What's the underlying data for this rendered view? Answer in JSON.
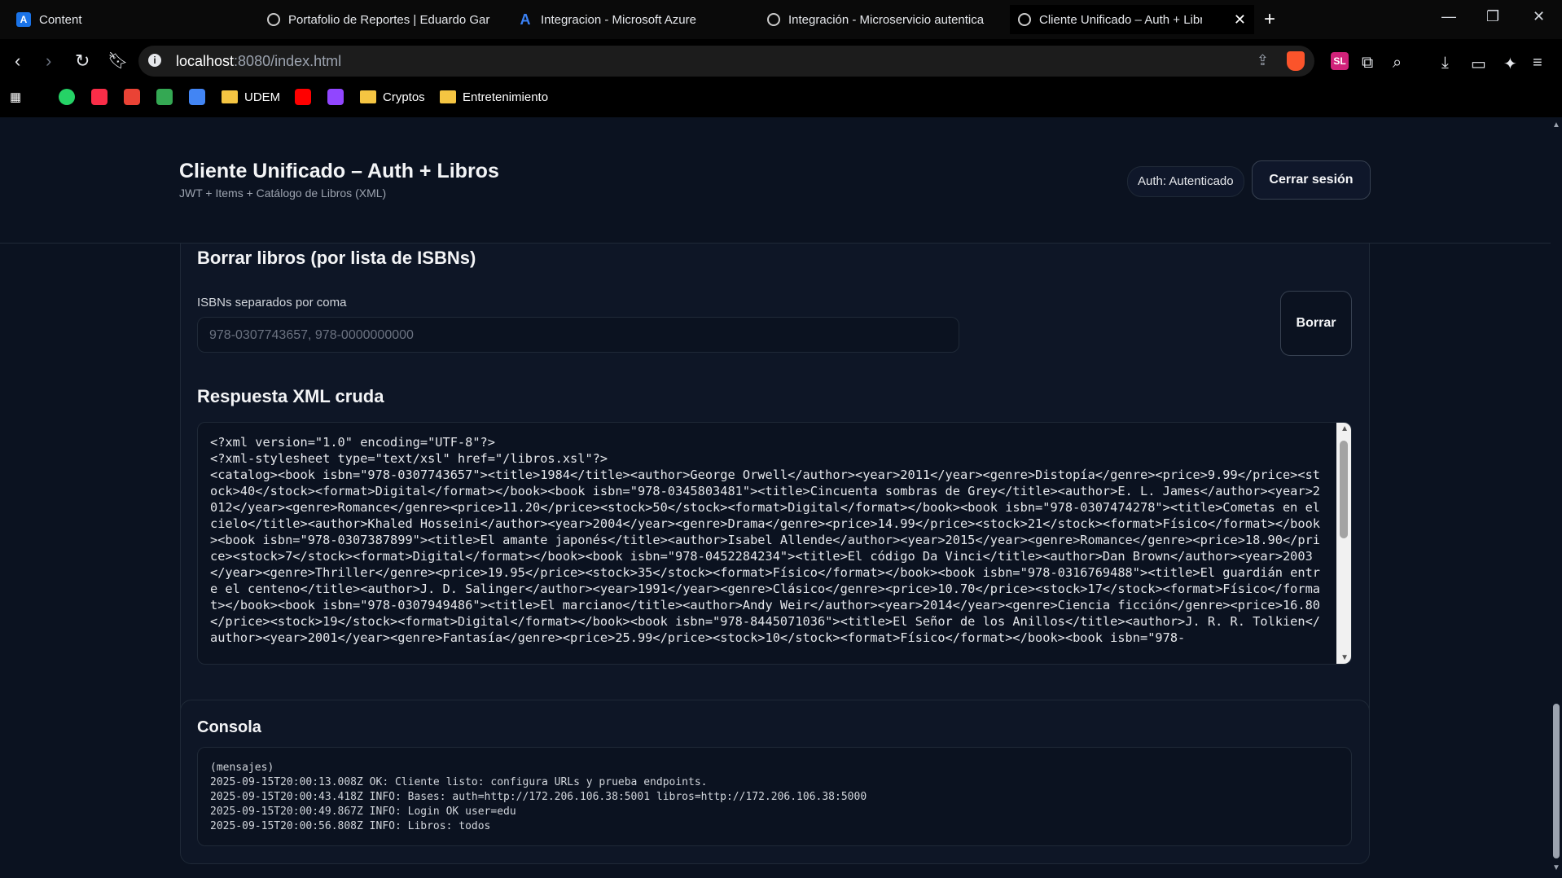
{
  "browser": {
    "tabs": [
      {
        "title": "Content",
        "favicon": "A"
      },
      {
        "title": "Portafolio de Reportes | Eduardo Gar",
        "favicon": "globe"
      },
      {
        "title": "Integracion - Microsoft Azure",
        "favicon": "azure"
      },
      {
        "title": "Integración - Microservicio autentica",
        "favicon": "openai"
      },
      {
        "title": "Cliente Unificado – Auth + Libros",
        "favicon": "globe"
      }
    ],
    "url_host": "localhost",
    "url_rest": ":8080/index.html",
    "bookmarks": [
      "UDEM",
      "Cryptos",
      "Entretenimiento"
    ],
    "ext_sl": "SL"
  },
  "header": {
    "title": "Cliente Unificado – Auth + Libros",
    "subtitle": "JWT + Items + Catálogo de Libros (XML)",
    "auth_status": "Auth: Autenticado",
    "logout_label": "Cerrar sesión"
  },
  "delete_section": {
    "title": "Borrar libros (por lista de ISBNs)",
    "label": "ISBNs separados por coma",
    "placeholder": "978-0307743657, 978-0000000000",
    "button": "Borrar"
  },
  "xml_section": {
    "title": "Respuesta XML cruda",
    "content": "<?xml version=\"1.0\" encoding=\"UTF-8\"?>\n<?xml-stylesheet type=\"text/xsl\" href=\"/libros.xsl\"?>\n<catalog><book isbn=\"978-0307743657\"><title>1984</title><author>George Orwell</author><year>2011</year><genre>Distopía</genre><price>9.99</price><stock>40</stock><format>Digital</format></book><book isbn=\"978-0345803481\"><title>Cincuenta sombras de Grey</title><author>E. L. James</author><year>2012</year><genre>Romance</genre><price>11.20</price><stock>50</stock><format>Digital</format></book><book isbn=\"978-0307474278\"><title>Cometas en el cielo</title><author>Khaled Hosseini</author><year>2004</year><genre>Drama</genre><price>14.99</price><stock>21</stock><format>Físico</format></book><book isbn=\"978-0307387899\"><title>El amante japonés</title><author>Isabel Allende</author><year>2015</year><genre>Romance</genre><price>18.90</price><stock>7</stock><format>Digital</format></book><book isbn=\"978-0452284234\"><title>El código Da Vinci</title><author>Dan Brown</author><year>2003</year><genre>Thriller</genre><price>19.95</price><stock>35</stock><format>Físico</format></book><book isbn=\"978-0316769488\"><title>El guardián entre el centeno</title><author>J. D. Salinger</author><year>1991</year><genre>Clásico</genre><price>10.70</price><stock>17</stock><format>Físico</format></book><book isbn=\"978-0307949486\"><title>El marciano</title><author>Andy Weir</author><year>2014</year><genre>Ciencia ficción</genre><price>16.80</price><stock>19</stock><format>Digital</format></book><book isbn=\"978-8445071036\"><title>El Señor de los Anillos</title><author>J. R. R. Tolkien</author><year>2001</year><genre>Fantasía</genre><price>25.99</price><stock>10</stock><format>Físico</format></book><book isbn=\"978-"
  },
  "console": {
    "title": "Consola",
    "lines": [
      "(mensajes)",
      "2025-09-15T20:00:13.008Z OK: Cliente listo: configura URLs y prueba endpoints.",
      "2025-09-15T20:00:43.418Z INFO: Bases: auth=http://172.206.106.38:5001 libros=http://172.206.106.38:5000",
      "2025-09-15T20:00:49.867Z INFO: Login OK user=edu",
      "2025-09-15T20:00:56.808Z INFO: Libros: todos"
    ]
  }
}
